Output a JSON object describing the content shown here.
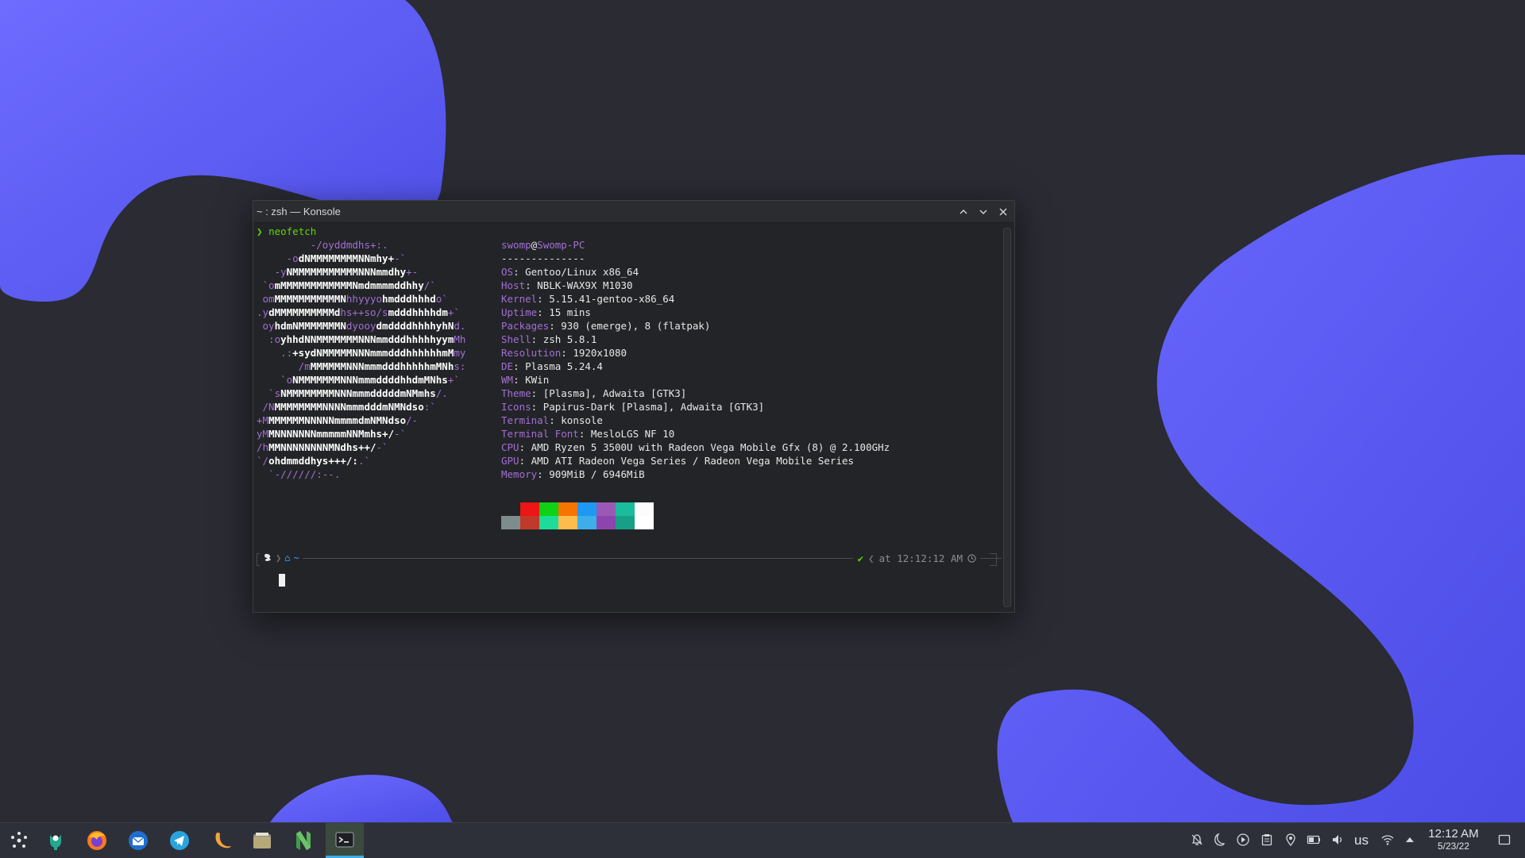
{
  "window": {
    "title": "~ : zsh — Konsole"
  },
  "terminal": {
    "prompt_char": "❯",
    "command": "neofetch",
    "art_lines": [
      [
        [
          "p",
          "         -/oyddmdhs+:."
        ]
      ],
      [
        [
          "p",
          "     -o"
        ],
        [
          "w",
          "dNMMMMMMMMNNmhy+"
        ],
        [
          "p",
          "-`"
        ]
      ],
      [
        [
          "p",
          "   -y"
        ],
        [
          "w",
          "NMMMMMMMMMMMNNNmmdhy"
        ],
        [
          "p",
          "+-"
        ]
      ],
      [
        [
          "p",
          " `o"
        ],
        [
          "w",
          "mMMMMMMMMMMMMNmdmmmmddhhy"
        ],
        [
          "p",
          "/`"
        ]
      ],
      [
        [
          "p",
          " om"
        ],
        [
          "w",
          "MMMMMMMMMMMN"
        ],
        [
          "p",
          "hhyyyo"
        ],
        [
          "w",
          "hmdddhhhd"
        ],
        [
          "p",
          "o`"
        ]
      ],
      [
        [
          "p",
          ".y"
        ],
        [
          "w",
          "dMMMMMMMMMMd"
        ],
        [
          "p",
          "hs++so/s"
        ],
        [
          "w",
          "mdddhhhhdm"
        ],
        [
          "p",
          "+`"
        ]
      ],
      [
        [
          "p",
          " oy"
        ],
        [
          "w",
          "hdmNMMMMMMMN"
        ],
        [
          "p",
          "dyooy"
        ],
        [
          "w",
          "dmddddhhhhyhN"
        ],
        [
          "p",
          "d."
        ]
      ],
      [
        [
          "p",
          "  :o"
        ],
        [
          "w",
          "yhhdNNMMMMMMMNNNmmdddhhhhhyym"
        ],
        [
          "p",
          "Mh"
        ]
      ],
      [
        [
          "p",
          "    .:"
        ],
        [
          "w",
          "+sydNMMMMMNNNmmmdddhhhhhhmM"
        ],
        [
          "p",
          "my"
        ]
      ],
      [
        [
          "p",
          "       /m"
        ],
        [
          "w",
          "MMMMMMNNNmmmdddhhhhhmMNh"
        ],
        [
          "p",
          "s:"
        ]
      ],
      [
        [
          "p",
          "    `o"
        ],
        [
          "w",
          "NMMMMMMMNNNmmmddddhhdmMNhs"
        ],
        [
          "p",
          "+`"
        ]
      ],
      [
        [
          "p",
          "  `s"
        ],
        [
          "w",
          "NMMMMMMMMNNNmmmdddddmNMmhs"
        ],
        [
          "p",
          "/."
        ]
      ],
      [
        [
          "p",
          " /N"
        ],
        [
          "w",
          "MMMMMMMMNNNNmmmdddmNMNdso"
        ],
        [
          "p",
          ":`"
        ]
      ],
      [
        [
          "p",
          "+M"
        ],
        [
          "w",
          "MMMMMMNNNNNmmmmdmNMNdso"
        ],
        [
          "p",
          "/-"
        ]
      ],
      [
        [
          "p",
          "yM"
        ],
        [
          "w",
          "MNNNNNNNmmmmmNNMmhs+/"
        ],
        [
          "p",
          "-`"
        ]
      ],
      [
        [
          "p",
          "/h"
        ],
        [
          "w",
          "MMNNNNNNNNMNdhs++/"
        ],
        [
          "p",
          "-`"
        ]
      ],
      [
        [
          "p",
          "`/"
        ],
        [
          "w",
          "ohdmmddhys+++/:"
        ],
        [
          "p",
          ".`"
        ]
      ],
      [
        [
          "p",
          "  `-//////:--."
        ]
      ]
    ],
    "user": "swomp",
    "at": "@",
    "host": "Swomp-PC",
    "separator": "--------------",
    "info": [
      {
        "key": "OS",
        "value": "Gentoo/Linux x86_64"
      },
      {
        "key": "Host",
        "value": "NBLK-WAX9X M1030"
      },
      {
        "key": "Kernel",
        "value": "5.15.41-gentoo-x86_64"
      },
      {
        "key": "Uptime",
        "value": "15 mins"
      },
      {
        "key": "Packages",
        "value": "930 (emerge), 8 (flatpak)"
      },
      {
        "key": "Shell",
        "value": "zsh 5.8.1"
      },
      {
        "key": "Resolution",
        "value": "1920x1080"
      },
      {
        "key": "DE",
        "value": "Plasma 5.24.4"
      },
      {
        "key": "WM",
        "value": "KWin"
      },
      {
        "key": "Theme",
        "value": "[Plasma], Adwaita [GTK3]"
      },
      {
        "key": "Icons",
        "value": "Papirus-Dark [Plasma], Adwaita [GTK3]"
      },
      {
        "key": "Terminal",
        "value": "konsole"
      },
      {
        "key": "Terminal Font",
        "value": "MesloLGS NF 10"
      },
      {
        "key": "CPU",
        "value": "AMD Ryzen 5 3500U with Radeon Vega Mobile Gfx (8) @ 2.100GHz"
      },
      {
        "key": "GPU",
        "value": "AMD ATI Radeon Vega Series / Radeon Vega Mobile Series"
      },
      {
        "key": "Memory",
        "value": "909MiB / 6946MiB"
      }
    ],
    "palette_top": [
      "#232427",
      "#ed1515",
      "#11d116",
      "#f67400",
      "#1d99f3",
      "#9b59b6",
      "#1abc9c",
      "#fcfcfc"
    ],
    "palette_bottom": [
      "#7f8c8d",
      "#c0392b",
      "#1cdc9a",
      "#fdbc4b",
      "#3daee9",
      "#8e44ad",
      "#16a085",
      "#ffffff"
    ],
    "p10k_dir": "~",
    "p10k_status": "✔",
    "p10k_time": "at 12:12:12 AM"
  },
  "taskbar": {
    "apps": [
      {
        "name": "launcher",
        "icon": "kde-launcher-icon"
      },
      {
        "name": "gentoo",
        "icon": "portage-icon"
      },
      {
        "name": "firefox",
        "icon": "firefox-icon"
      },
      {
        "name": "thunderbird",
        "icon": "mail-icon"
      },
      {
        "name": "telegram",
        "icon": "telegram-icon"
      },
      {
        "name": "night-light",
        "icon": "crescent-icon"
      },
      {
        "name": "files",
        "icon": "folder-icon"
      },
      {
        "name": "neovim",
        "icon": "neovim-icon"
      },
      {
        "name": "konsole",
        "icon": "terminal-icon"
      }
    ],
    "keyboard_layout": "us",
    "time": "12:12 AM",
    "date": "5/23/22"
  },
  "colors": {
    "accent": "#3daee9",
    "wallpaper_blob": "#5b5cf6",
    "purple": "#a26fd6",
    "green": "#5fd700"
  }
}
